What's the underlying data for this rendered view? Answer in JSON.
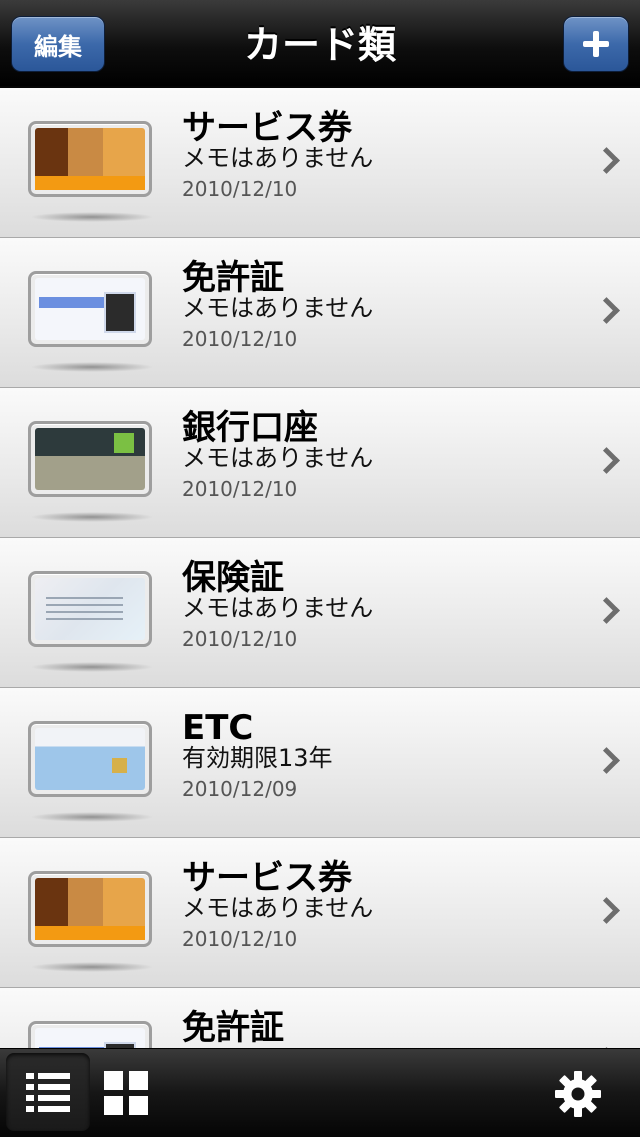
{
  "navbar": {
    "title": "カード類",
    "edit_label": "編集"
  },
  "cards": [
    {
      "title": "サービス券",
      "memo": "メモはありません",
      "date": "2010/12/10",
      "art": "pass"
    },
    {
      "title": "免許証",
      "memo": "メモはありません",
      "date": "2010/12/10",
      "art": "license"
    },
    {
      "title": "銀行口座",
      "memo": "メモはありません",
      "date": "2010/12/10",
      "art": "bank"
    },
    {
      "title": "保険証",
      "memo": "メモはありません",
      "date": "2010/12/10",
      "art": "insure"
    },
    {
      "title": "ETC",
      "memo": "有効期限13年",
      "date": "2010/12/09",
      "art": "etc"
    },
    {
      "title": "サービス券",
      "memo": "メモはありません",
      "date": "2010/12/10",
      "art": "pass"
    },
    {
      "title": "免許証",
      "memo": "",
      "date": "",
      "art": "license"
    }
  ],
  "tabbar": {
    "icons": [
      "list-view-icon",
      "grid-view-icon",
      "gear-icon"
    ],
    "selected": "list-view-icon"
  }
}
